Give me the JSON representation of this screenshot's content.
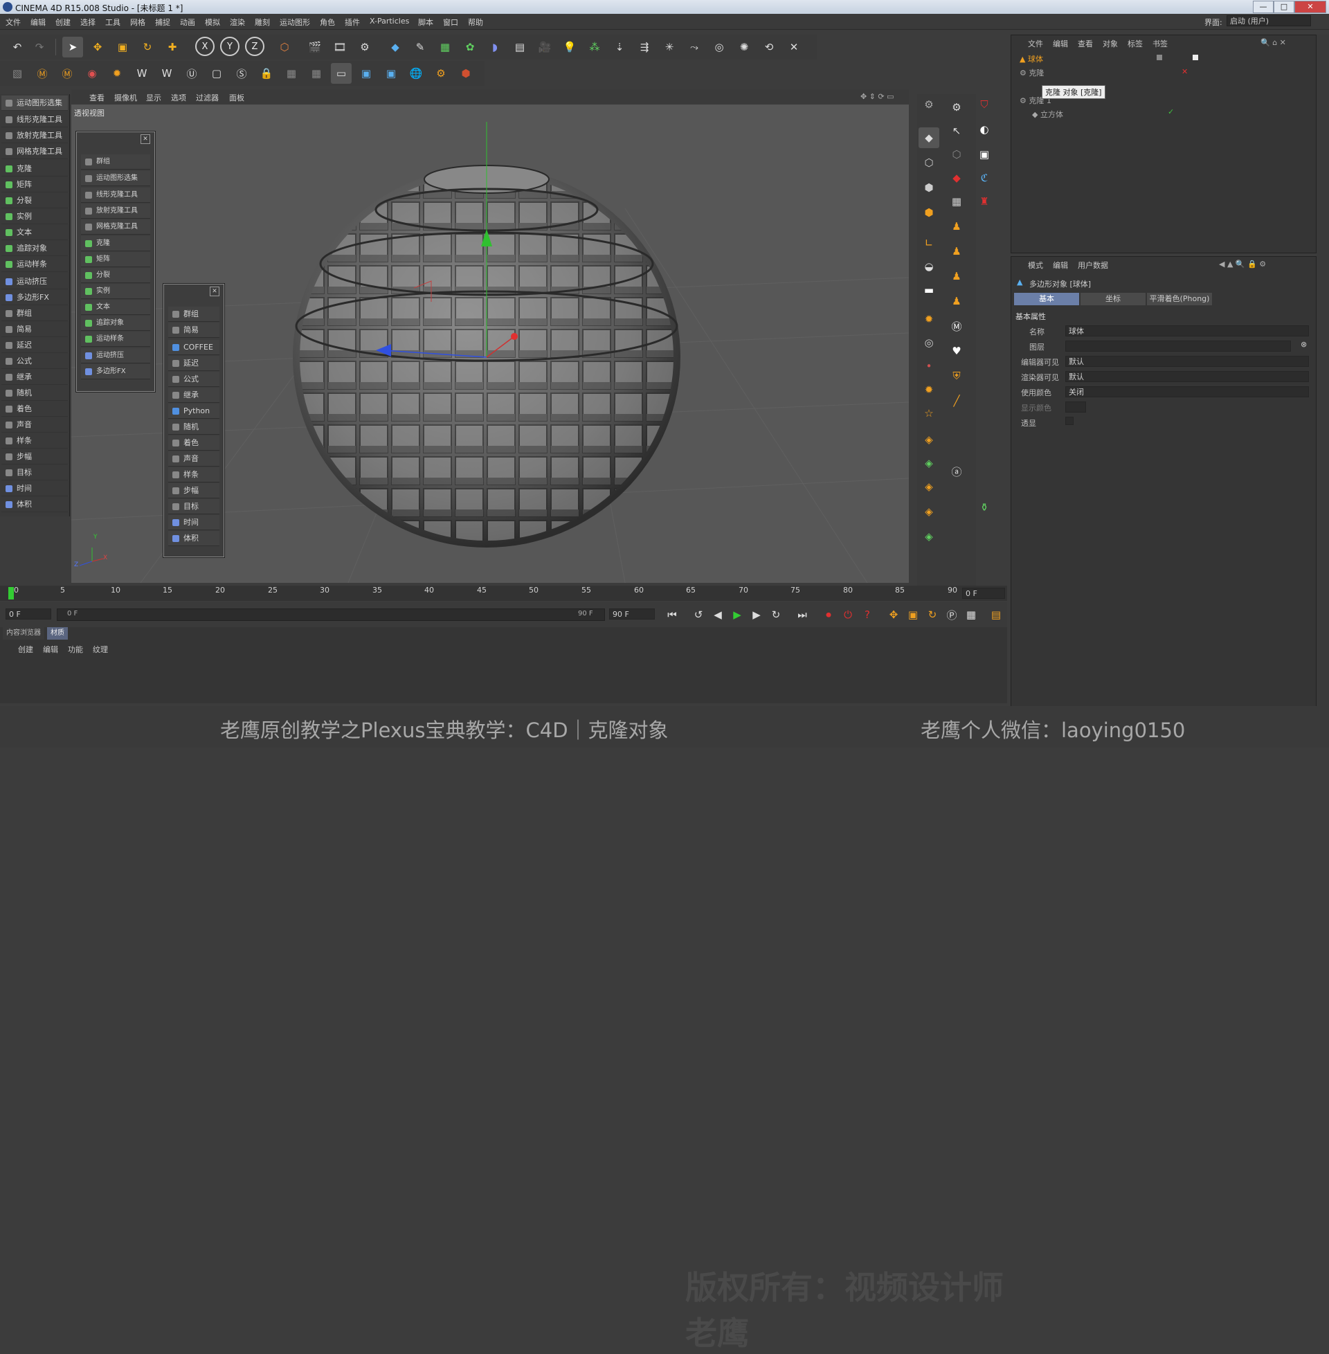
{
  "window": {
    "title": "CINEMA 4D R15.008 Studio - [未标题 1 *]",
    "min": "—",
    "max": "□",
    "close": "✕"
  },
  "menu": [
    "文件",
    "编辑",
    "创建",
    "选择",
    "工具",
    "网格",
    "捕捉",
    "动画",
    "模拟",
    "渲染",
    "雕刻",
    "运动图形",
    "角色",
    "插件",
    "X-Particles",
    "脚本",
    "窗口",
    "帮助"
  ],
  "layout": {
    "label": "界面:",
    "value": "启动 (用户)"
  },
  "axis_buttons": [
    "X",
    "Y",
    "Z"
  ],
  "left_palette": [
    "运动图形选集",
    "线形克隆工具",
    "放射克隆工具",
    "网格克隆工具",
    "克隆",
    "矩阵",
    "分裂",
    "实例",
    "文本",
    "追踪对象",
    "运动样条",
    "运动挤压",
    "多边形FX",
    "群组",
    "简易",
    "延迟",
    "公式",
    "继承",
    "随机",
    "着色",
    "声音",
    "样条",
    "步幅",
    "目标",
    "时间",
    "体积"
  ],
  "viewport": {
    "menu": [
      "查看",
      "摄像机",
      "显示",
      "选项",
      "过滤器",
      "面板"
    ],
    "label": "透视视图",
    "axes": {
      "x": "X",
      "y": "Y",
      "z": "Z"
    }
  },
  "palette1": [
    "群组",
    "运动图形选集",
    "线形克隆工具",
    "放射克隆工具",
    "网格克隆工具",
    "克隆",
    "矩阵",
    "分裂",
    "实例",
    "文本",
    "追踪对象",
    "运动样条",
    "运动挤压",
    "多边形FX"
  ],
  "palette2": [
    "群组",
    "简易",
    "COFFEE",
    "延迟",
    "公式",
    "继承",
    "Python",
    "随机",
    "着色",
    "声音",
    "样条",
    "步幅",
    "目标",
    "时间",
    "体积"
  ],
  "object_manager": {
    "menu": [
      "文件",
      "编辑",
      "查看",
      "对象",
      "标签",
      "书签"
    ],
    "rows": [
      "球体",
      "克隆",
      "",
      "克隆 1",
      "立方体"
    ],
    "tooltip": "克隆 对象 [克隆]"
  },
  "attribute_manager": {
    "menu": [
      "模式",
      "编辑",
      "用户数据"
    ],
    "title": "多边形对象 [球体]",
    "tabs": [
      "基本",
      "坐标",
      "平滑着色(Phong)"
    ],
    "section": "基本属性",
    "fields": [
      {
        "label": "名称",
        "value": "球体"
      },
      {
        "label": "图层",
        "value": ""
      },
      {
        "label": "编辑器可见",
        "value": "默认"
      },
      {
        "label": "渲染器可见",
        "value": "默认"
      },
      {
        "label": "使用颜色",
        "value": "关闭"
      },
      {
        "label": "显示颜色",
        "value": ""
      },
      {
        "label": "透显",
        "value": ""
      }
    ]
  },
  "timeline": {
    "ticks": [
      "0",
      "5",
      "10",
      "15",
      "20",
      "25",
      "30",
      "35",
      "40",
      "45",
      "50",
      "55",
      "60",
      "65",
      "70",
      "75",
      "80",
      "85",
      "90"
    ],
    "current": "0 F",
    "start": "0 F",
    "range_start": "0 F",
    "range_end": "90 F",
    "end": "90 F"
  },
  "material": {
    "tabs": [
      "内容浏览器",
      "材质"
    ],
    "menu": [
      "创建",
      "编辑",
      "功能",
      "纹理"
    ]
  },
  "watermark": "版权所有：视频设计师老鹰",
  "caption": {
    "left": "老鹰原创教学之Plexus宝典教学：C4D｜克隆对象",
    "right": "老鹰个人微信：laoying0150"
  },
  "colors": {
    "viewport_bg": "#575757",
    "ui_bg": "#3a3a3a",
    "x_axis": "#d03030",
    "y_axis": "#30c030",
    "z_axis": "#3050e0",
    "selected": "#f0a020"
  }
}
